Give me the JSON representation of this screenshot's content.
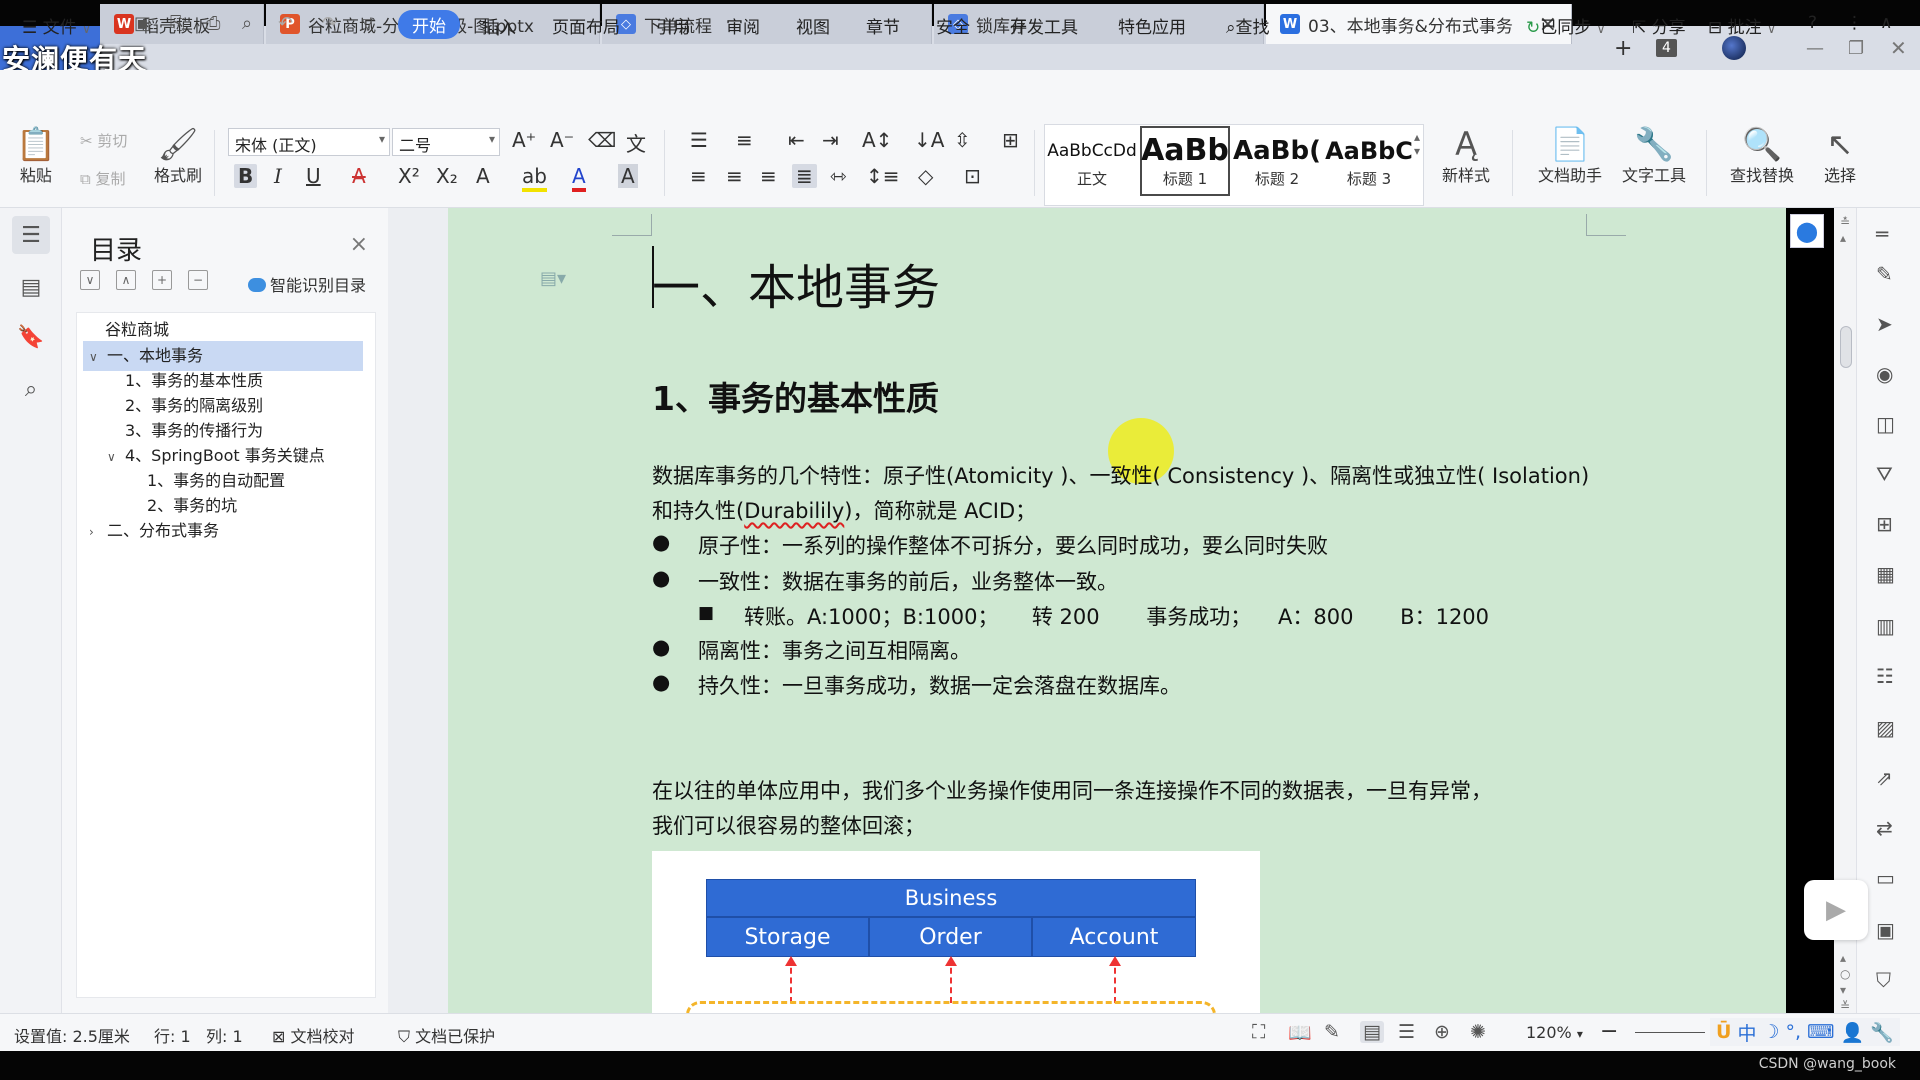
{
  "watermark": "安澜便有天",
  "tabs": [
    {
      "label": "稻壳模板",
      "icon": "wps-icon",
      "color": "#d9341f"
    },
    {
      "label": "谷粒商城-分布式高级-图.pptx",
      "icon": "pptx-icon",
      "color": "#e0552b"
    },
    {
      "label": "下单流程",
      "icon": "flow-icon",
      "color": "#4a7be0"
    },
    {
      "label": "锁库存",
      "icon": "flow-icon",
      "color": "#4a7be0"
    },
    {
      "label": "03、本地事务&分布式事务",
      "icon": "docx-icon",
      "color": "#2b6fe0"
    }
  ],
  "tab_count": "4",
  "menu": {
    "file": "文件",
    "items": [
      "开始",
      "插入",
      "页面布局",
      "引用",
      "审阅",
      "视图",
      "章节",
      "安全",
      "开发工具",
      "特色应用"
    ],
    "active": "开始",
    "search": "查找",
    "synced": "已同步",
    "share": "分享",
    "comment": "批注"
  },
  "ribbon": {
    "paste": "粘贴",
    "cut": "剪切",
    "copy": "复制",
    "format_painter": "格式刷",
    "font_name": "宋体 (正文)",
    "font_size": "二号",
    "styles": [
      {
        "sample": "AaBbCcDd",
        "label": "正文"
      },
      {
        "sample": "AaBb",
        "label": "标题 1"
      },
      {
        "sample": "AaBb(",
        "label": "标题 2"
      },
      {
        "sample": "AaBbC",
        "label": "标题 3"
      }
    ],
    "new_style": "新样式",
    "doc_helper": "文档助手",
    "text_tools": "文字工具",
    "find_replace": "查找替换",
    "select": "选择"
  },
  "toc": {
    "title": "目录",
    "smart": "智能识别目录",
    "items": [
      {
        "label": "谷粒商城",
        "level": 0,
        "arrow": ""
      },
      {
        "label": "一、本地事务",
        "level": 0,
        "arrow": "∨",
        "selected": true
      },
      {
        "label": "1、事务的基本性质",
        "level": 1,
        "arrow": ""
      },
      {
        "label": "2、事务的隔离级别",
        "level": 1,
        "arrow": ""
      },
      {
        "label": "3、事务的传播行为",
        "level": 1,
        "arrow": ""
      },
      {
        "label": "4、SpringBoot 事务关键点",
        "level": 1,
        "arrow": "∨"
      },
      {
        "label": "1、事务的自动配置",
        "level": 2,
        "arrow": ""
      },
      {
        "label": "2、事务的坑",
        "level": 2,
        "arrow": ""
      },
      {
        "label": "二、分布式事务",
        "level": 0,
        "arrow": "›"
      }
    ]
  },
  "doc": {
    "h1": "一、本地事务",
    "h2": "1、事务的基本性质",
    "p1a": "数据库事务的几个特性：原子性(Atomicity )、一致性( Consistency )、隔离性或独立性( Isolation)",
    "p1b_pre": "和持久性(",
    "p1b_word": "Durabilily",
    "p1b_post": ")，简称就是 ACID；",
    "bullets": [
      "原子性：一系列的操作整体不可拆分，要么同时成功，要么同时失败",
      "一致性：数据在事务的前后，业务整体一致。",
      "隔离性：事务之间互相隔离。",
      "持久性：一旦事务成功，数据一定会落盘在数据库。"
    ],
    "sub_bullet": "转账。A:1000；B:1000；     转 200       事务成功；    A：800       B：1200",
    "p2a": "在以往的单体应用中，我们多个业务操作使用同一条连接操作不同的数据表，一旦有异常，",
    "p2b": "我们可以很容易的整体回滚；",
    "diagram": {
      "top": "Business",
      "services": [
        "Storage",
        "Order",
        "Account"
      ]
    }
  },
  "status": {
    "setting": "设置值: 2.5厘米",
    "row": "行: 1",
    "col": "列: 1",
    "proof": "文档校对",
    "protected": "文档已保护",
    "zoom": "120%"
  },
  "ime": [
    "中"
  ],
  "credit": "CSDN @wang_book"
}
